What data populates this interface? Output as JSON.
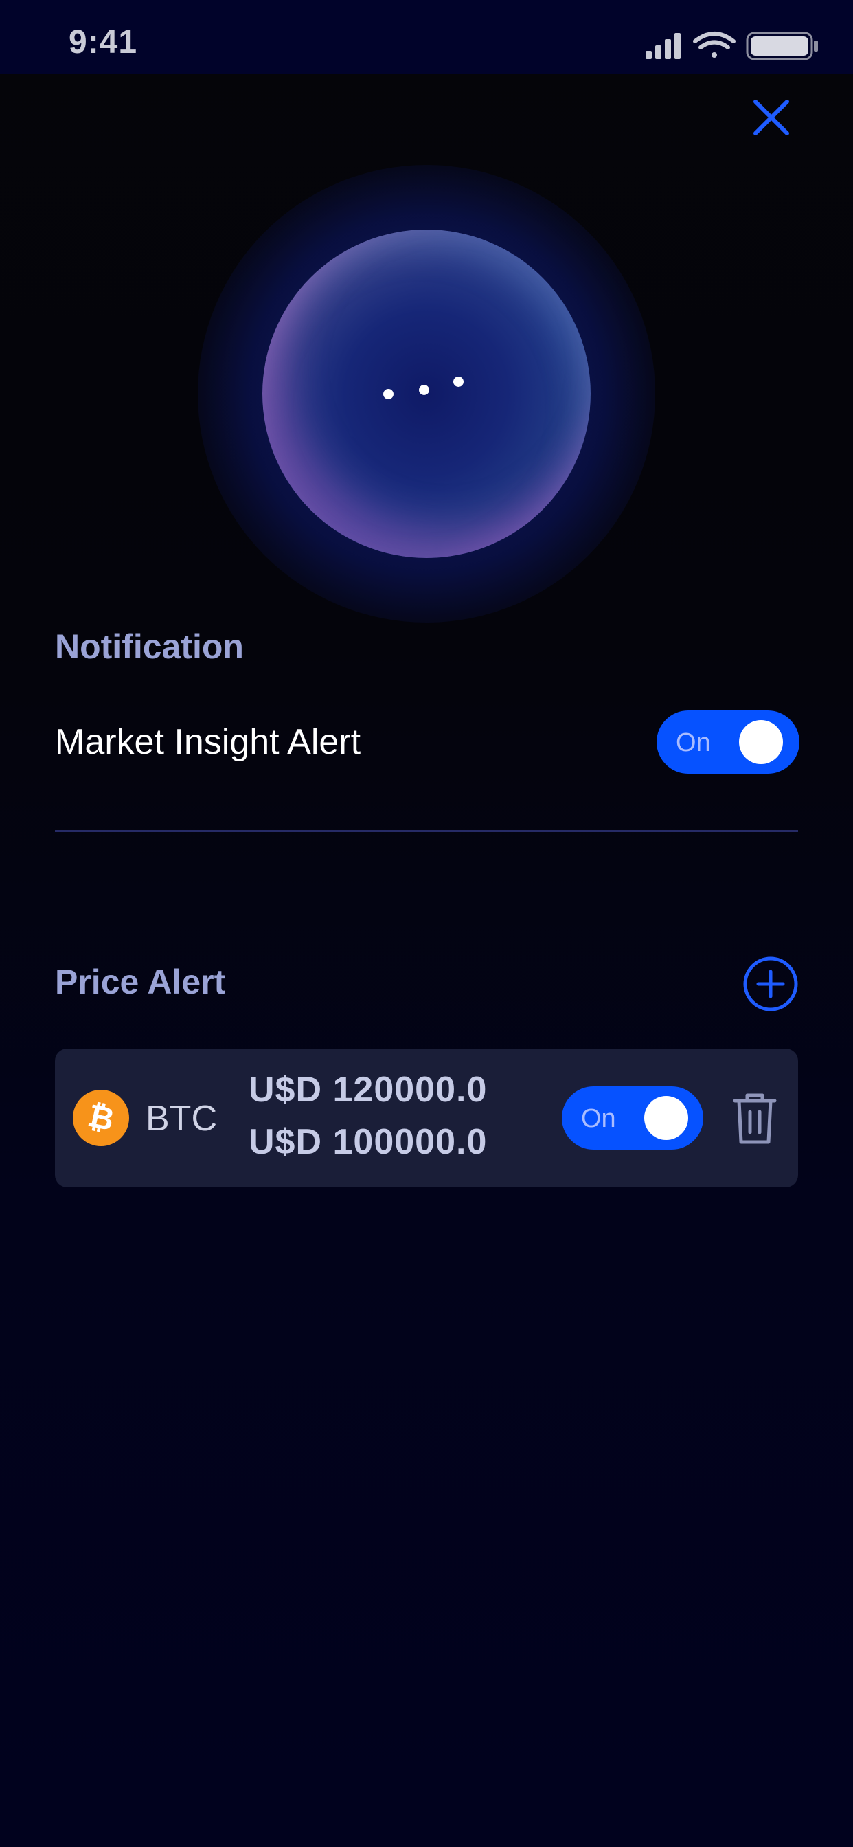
{
  "status_bar": {
    "time": "9:41",
    "icons": [
      "cellular-signal-icon",
      "wifi-icon",
      "battery-icon"
    ]
  },
  "header": {
    "close_icon": "close-icon"
  },
  "notification_section": {
    "title": "Notification",
    "market_insight": {
      "label": "Market Insight Alert",
      "toggle_text": "On",
      "enabled": true
    }
  },
  "price_alert_section": {
    "title": "Price Alert",
    "add_icon": "add-circle-icon",
    "alerts": [
      {
        "coin": "BTC",
        "coin_icon": "bitcoin-icon",
        "upper_price": "U$D 120000.0",
        "lower_price": "U$D 100000.0",
        "toggle_text": "On",
        "enabled": true,
        "delete_icon": "trash-icon"
      }
    ]
  },
  "colors": {
    "accent": "#0652ff",
    "section_title": "#9aa3d6",
    "card_bg": "#1a1e38",
    "bitcoin_orange": "#f7931a"
  }
}
